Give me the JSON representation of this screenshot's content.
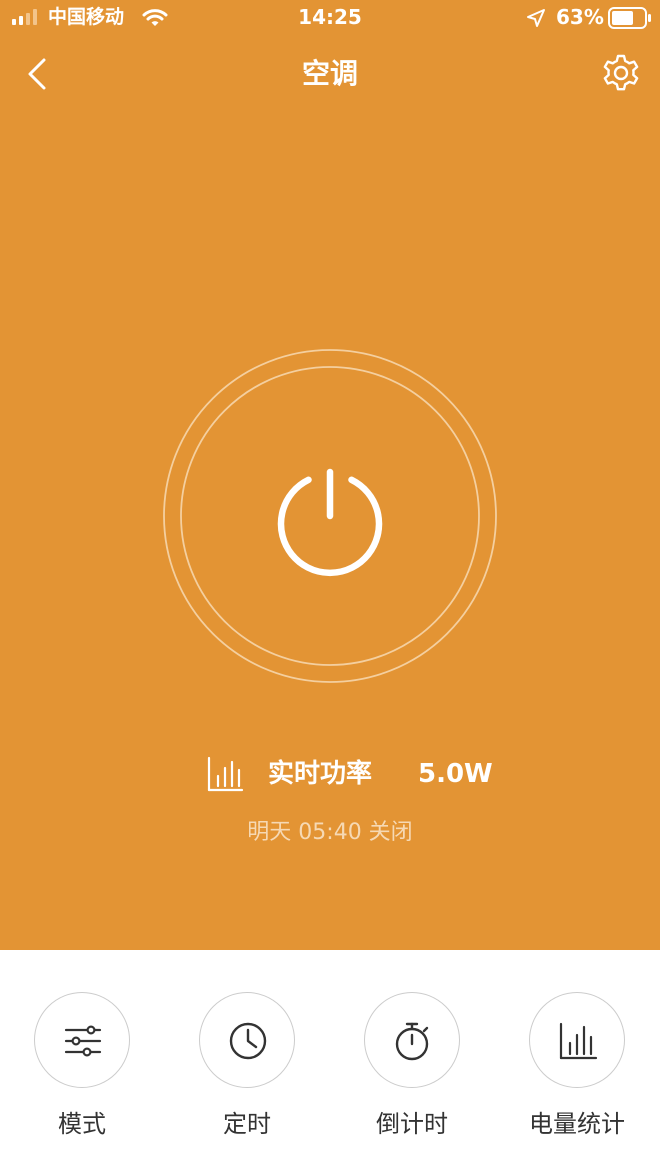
{
  "colors": {
    "accent": "#E39434",
    "on_accent": "#FFFFFF",
    "schedule_text": "#F6D9B4",
    "toolbar_icon": "#333333",
    "toolbar_circle": "#CCCCCC"
  },
  "status_bar": {
    "carrier": "中国移动",
    "time": "14:25",
    "battery": "63%",
    "icons": [
      "signal-icon",
      "wifi-icon",
      "location-icon",
      "battery-icon"
    ]
  },
  "nav": {
    "title": "空调",
    "back_icon": "chevron-left-icon",
    "settings_icon": "gear-icon"
  },
  "power_button": {
    "icon": "power-icon"
  },
  "power_info": {
    "icon": "bar-chart-icon",
    "label": "实时功率",
    "value": "5.0W"
  },
  "schedule": {
    "text": "明天 05:40  关闭"
  },
  "toolbar": [
    {
      "label": "模式",
      "icon": "sliders-icon"
    },
    {
      "label": "定时",
      "icon": "clock-icon"
    },
    {
      "label": "倒计时",
      "icon": "stopwatch-icon"
    },
    {
      "label": "电量统计",
      "icon": "bar-chart-icon"
    }
  ]
}
